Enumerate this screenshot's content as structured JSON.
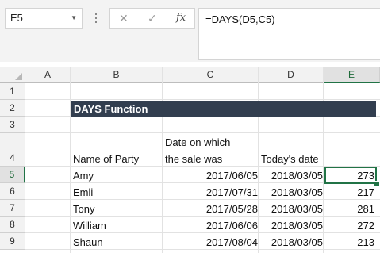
{
  "name_box": "E5",
  "formula": "=DAYS(D5,C5)",
  "columns": [
    "A",
    "B",
    "C",
    "D",
    "E"
  ],
  "rows": [
    "1",
    "2",
    "3",
    "4",
    "5",
    "6",
    "7",
    "8",
    "9"
  ],
  "title": "DAYS Function",
  "headers": {
    "name": "Name of Party",
    "sale_line1": "Date on which",
    "sale_line2": "the sale was",
    "today": "Today's date"
  },
  "records": [
    {
      "name": "Amy",
      "sale": "2017/06/05",
      "today": "2018/03/05",
      "days": "273"
    },
    {
      "name": "Emli",
      "sale": "2017/07/31",
      "today": "2018/03/05",
      "days": "217"
    },
    {
      "name": "Tony",
      "sale": "2017/05/28",
      "today": "2018/03/05",
      "days": "281"
    },
    {
      "name": "William",
      "sale": "2017/06/06",
      "today": "2018/03/05",
      "days": "272"
    },
    {
      "name": "Shaun",
      "sale": "2017/08/04",
      "today": "2018/03/05",
      "days": "213"
    }
  ],
  "icons": {
    "cancel": "close-icon",
    "enter": "check-icon",
    "function": "fx-icon"
  },
  "colors": {
    "title_fill": "#323e4f",
    "selection": "#217346"
  }
}
